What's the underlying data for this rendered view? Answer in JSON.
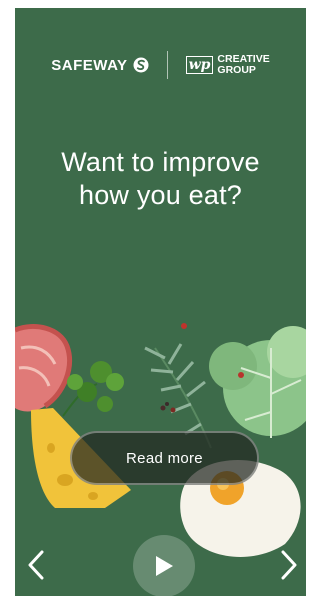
{
  "brand": {
    "safeway_name": "SAFEWAY",
    "wp_mark": "wp",
    "wp_line1": "CREATIVE",
    "wp_line2": "GROUP"
  },
  "headline": {
    "line1": "Want to improve",
    "line2": "how you eat?"
  },
  "cta": {
    "label": "Read more"
  },
  "controls": {
    "prev_icon": "chevron-left-icon",
    "next_icon": "chevron-right-icon",
    "play_icon": "play-icon"
  },
  "colors": {
    "background": "#3d6b4a",
    "text": "#ffffff",
    "button_bg": "#232822"
  }
}
